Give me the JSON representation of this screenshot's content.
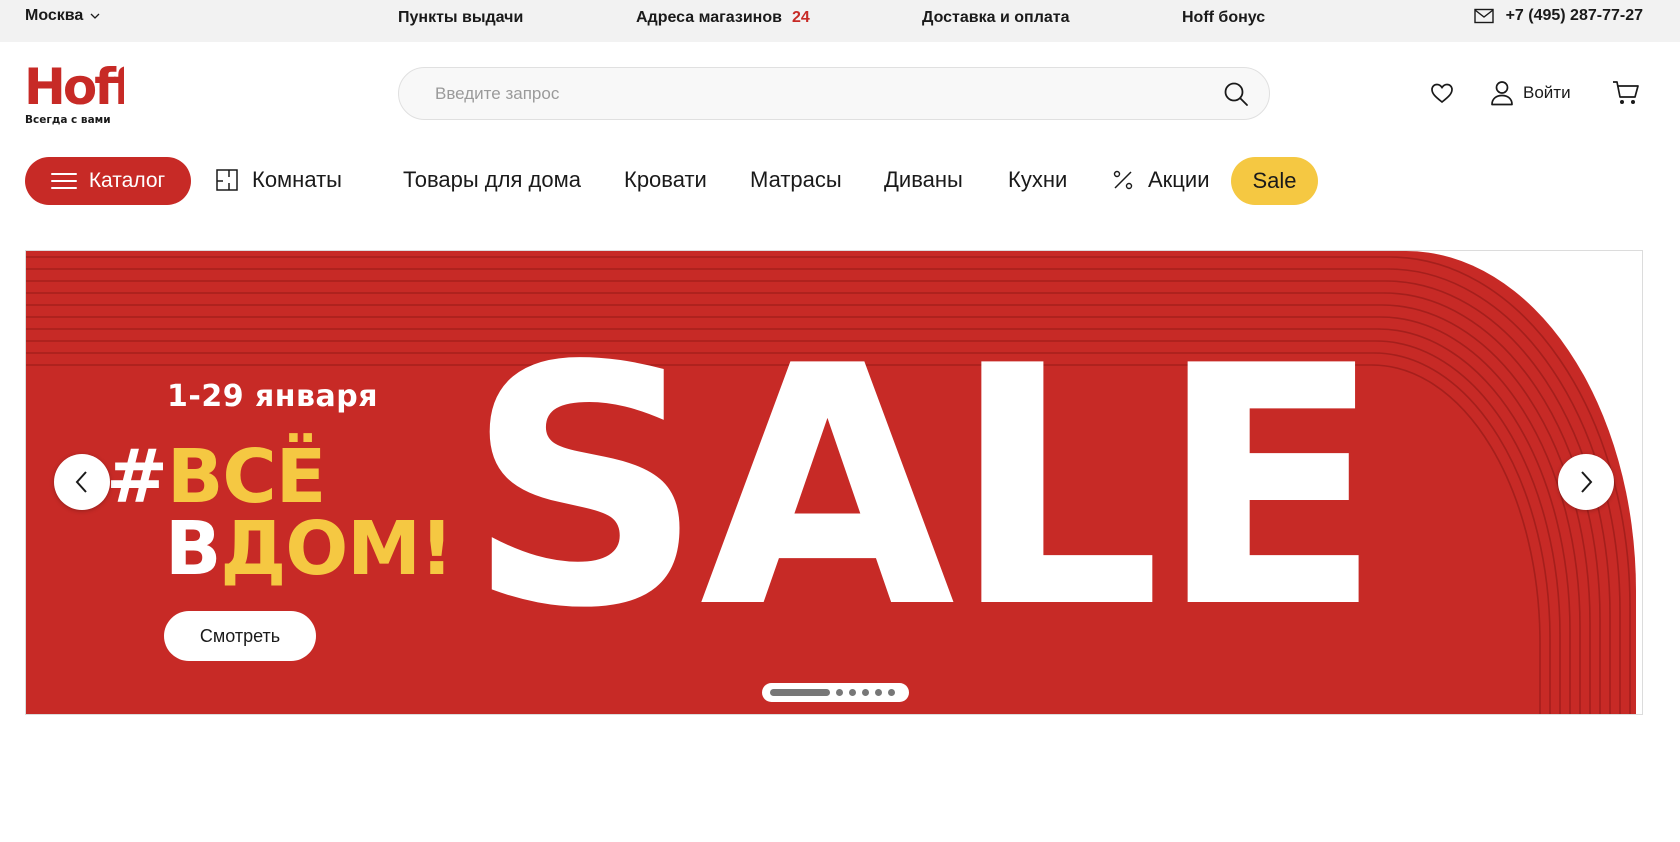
{
  "topbar": {
    "city": "Москва",
    "links": {
      "pickup": "Пункты выдачи",
      "stores": "Адреса магазинов",
      "stores_count": "24",
      "delivery": "Доставка и оплата",
      "bonus": "Hoff бонус"
    },
    "phone": "+7 (495) 287-77-27"
  },
  "header": {
    "logo_text": "Hoff",
    "logo_tagline": "Всегда с вами",
    "search_placeholder": "Введите запрос",
    "search_value": "",
    "login_label": "Войти"
  },
  "nav": {
    "catalog": "Каталог",
    "rooms": "Комнаты",
    "home_goods": "Товары для дома",
    "beds": "Кровати",
    "mattresses": "Матрасы",
    "sofas": "Диваны",
    "kitchens": "Кухни",
    "promos": "Акции",
    "sale": "Sale"
  },
  "banner": {
    "date": "1-29 января",
    "slogan_hash": "#",
    "slogan_line1": "ВСЁ",
    "slogan_line2_w": "В",
    "slogan_line2_y": "ДОМ!",
    "headline": "SALE",
    "cta": "Смотреть",
    "slides_total": 6,
    "active_slide": 1
  },
  "colors": {
    "brand_red": "#c72a26",
    "sale_yellow": "#f5c842",
    "topbar_bg": "#f2f2f2"
  },
  "icons": [
    "chevron-down-icon",
    "mail-icon",
    "search-icon",
    "heart-icon",
    "user-icon",
    "cart-icon",
    "hamburger-icon",
    "rooms-icon",
    "percent-icon",
    "arrow-left-icon",
    "arrow-right-icon"
  ]
}
